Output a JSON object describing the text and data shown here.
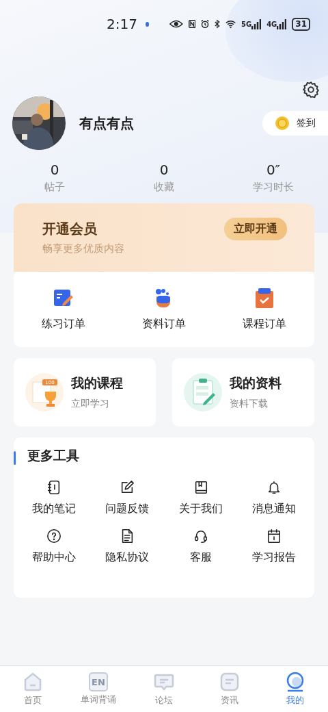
{
  "status_bar": {
    "time": "2:17",
    "network_1": "5G",
    "network_2": "4G",
    "battery": "31"
  },
  "profile": {
    "name": "有点有点",
    "checkin": "签到"
  },
  "stats": [
    {
      "value": "0",
      "label": "帖子"
    },
    {
      "value": "0",
      "label": "收藏"
    },
    {
      "value": "0″",
      "label": "学习时长"
    }
  ],
  "vip": {
    "title": "开通会员",
    "subtitle": "畅享更多优质内容",
    "button": "立即开通"
  },
  "orders": [
    {
      "kind": "practice",
      "label": "练习订单"
    },
    {
      "kind": "material",
      "label": "资料订单"
    },
    {
      "kind": "course",
      "label": "课程订单"
    }
  ],
  "cards": [
    {
      "kind": "course",
      "title": "我的课程",
      "subtitle": "立即学习",
      "badge": "100"
    },
    {
      "kind": "material",
      "title": "我的资料",
      "subtitle": "资料下载"
    }
  ],
  "tools": {
    "title": "更多工具",
    "items": [
      {
        "kind": "notebook",
        "label": "我的笔记"
      },
      {
        "kind": "edit",
        "label": "问题反馈"
      },
      {
        "kind": "book",
        "label": "关于我们"
      },
      {
        "kind": "bell",
        "label": "消息通知"
      },
      {
        "kind": "help",
        "label": "帮助中心"
      },
      {
        "kind": "document",
        "label": "隐私协议"
      },
      {
        "kind": "headset",
        "label": "客服"
      },
      {
        "kind": "calendar",
        "label": "学习报告"
      }
    ]
  },
  "nav": [
    {
      "kind": "home",
      "label": "首页",
      "selected": false
    },
    {
      "kind": "words",
      "label": "单词背诵",
      "icon_text": "EN",
      "selected": false
    },
    {
      "kind": "forum",
      "label": "论坛",
      "selected": false
    },
    {
      "kind": "news",
      "label": "资讯",
      "selected": false
    },
    {
      "kind": "me",
      "label": "我的",
      "selected": true
    }
  ]
}
